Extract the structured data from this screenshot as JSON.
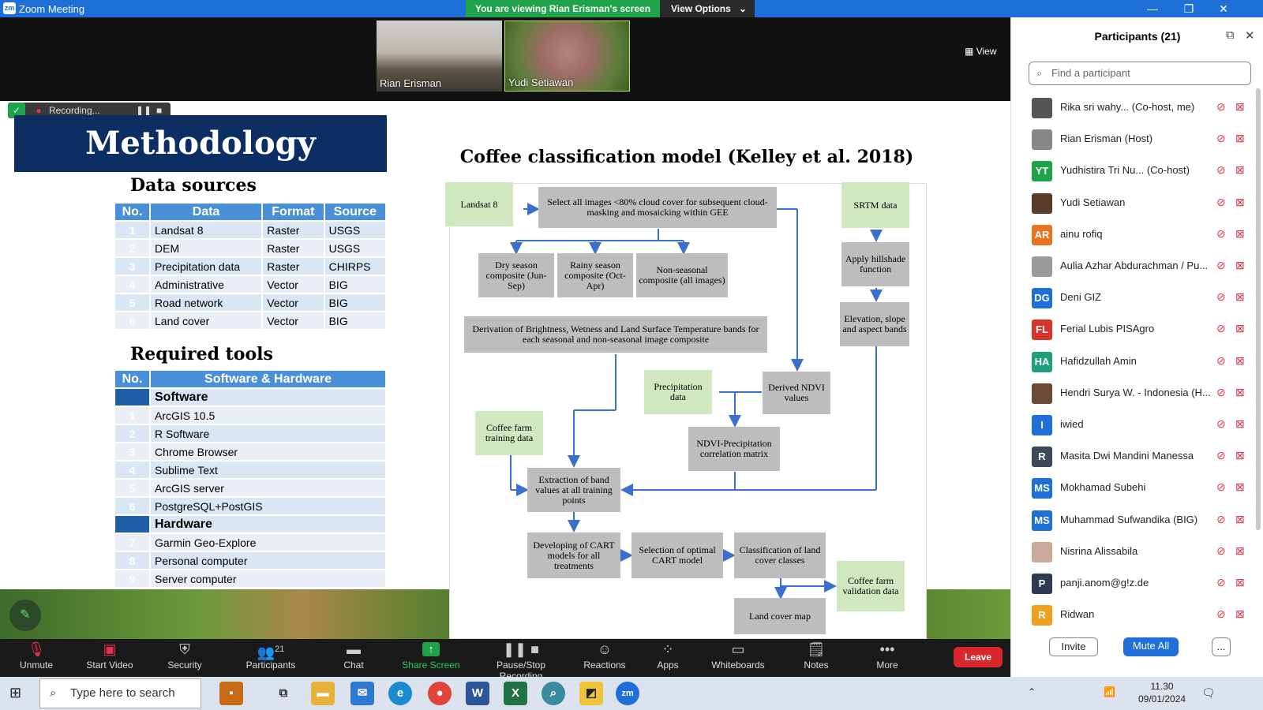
{
  "window": {
    "logo": "zm",
    "title": "Zoom Meeting",
    "banner": "You are viewing Rian Erisman's screen",
    "view_options": "View Options"
  },
  "video": {
    "tiles": [
      {
        "name": "Rian Erisman"
      },
      {
        "name": "Yudi Setiawan"
      }
    ],
    "view_label": "View"
  },
  "recording": {
    "label": "Recording..."
  },
  "slide": {
    "title": "Methodology",
    "data_sources_heading": "Data sources",
    "data_sources_columns": [
      "No.",
      "Data",
      "Format",
      "Source"
    ],
    "data_sources_rows": [
      [
        "1",
        "Landsat 8",
        "Raster",
        "USGS"
      ],
      [
        "2",
        "DEM",
        "Raster",
        "USGS"
      ],
      [
        "3",
        "Precipitation data",
        "Raster",
        "CHIRPS"
      ],
      [
        "4",
        "Administrative",
        "Vector",
        "BIG"
      ],
      [
        "5",
        "Road network",
        "Vector",
        "BIG"
      ],
      [
        "6",
        "Land cover",
        "Vector",
        "BIG"
      ]
    ],
    "tools_heading": "Required tools",
    "tools_columns": [
      "No.",
      "Software & Hardware"
    ],
    "software_label": "Software",
    "software": [
      [
        "1",
        "ArcGIS 10.5"
      ],
      [
        "2",
        "R Software"
      ],
      [
        "3",
        "Chrome Browser"
      ],
      [
        "4",
        "Sublime Text"
      ],
      [
        "5",
        "ArcGIS server"
      ],
      [
        "6",
        "PostgreSQL+PostGIS"
      ]
    ],
    "hardware_label": "Hardware",
    "hardware": [
      [
        "7",
        "Garmin Geo-Explore"
      ],
      [
        "8",
        "Personal computer"
      ],
      [
        "9",
        "Server computer"
      ]
    ],
    "diagram_title": "Coffee classification model (Kelley et al. 2018)",
    "diagram": {
      "landsat": "Landsat 8",
      "select": "Select all images <80% cloud cover for subsequent cloud-masking and mosaicking within GEE",
      "srtm": "SRTM data",
      "dry": "Dry season composite (Jun-Sep)",
      "rainy": "Rainy season composite (Oct-Apr)",
      "nonseasonal": "Non-seasonal composite (all images)",
      "hillshade": "Apply hillshade function",
      "derivation": "Derivation of Brightness, Wetness and Land Surface Temperature bands for each seasonal and non-seasonal image composite",
      "elevation": "Elevation, slope and aspect bands",
      "precip": "Precipitation data",
      "ndvi": "Derived NDVI values",
      "coffee_train": "Coffee farm training data",
      "corr": "NDVI-Precipitation correlation matrix",
      "extraction": "Extraction of band values at all training points",
      "developing": "Developing of CART models for all treatments",
      "selection": "Selection of optimal CART model",
      "classification": "Classification of land cover classes",
      "validation": "Coffee farm validation data",
      "landcover": "Land cover map"
    }
  },
  "participants": {
    "title": "Participants (21)",
    "search_placeholder": "Find a participant",
    "list": [
      {
        "name": "Rika sri wahy... (Co-host, me)",
        "initials": "",
        "color": "#555555"
      },
      {
        "name": "Rian Erisman (Host)",
        "initials": "",
        "color": "#888888"
      },
      {
        "name": "Yudhistira Tri Nu...  (Co-host)",
        "initials": "YT",
        "color": "#1fa34a"
      },
      {
        "name": "Yudi Setiawan",
        "initials": "",
        "color": "#5a3b2b"
      },
      {
        "name": "ainu rofiq",
        "initials": "AR",
        "color": "#e9731e"
      },
      {
        "name": "Aulia Azhar Abdurachman / Pu...",
        "initials": "",
        "color": "#9a9a9a"
      },
      {
        "name": "Deni GIZ",
        "initials": "DG",
        "color": "#1e6fd8"
      },
      {
        "name": "Ferial Lubis PISAgro",
        "initials": "FL",
        "color": "#d9342b"
      },
      {
        "name": "Hafidzullah Amin",
        "initials": "HA",
        "color": "#1fa07a"
      },
      {
        "name": "Hendri Surya W. - Indonesia (H...",
        "initials": "",
        "color": "#6b4a3a"
      },
      {
        "name": "iwied",
        "initials": "I",
        "color": "#1e6fd8"
      },
      {
        "name": "Masita Dwi Mandini Manessa",
        "initials": "R",
        "color": "#3e4a5a"
      },
      {
        "name": "Mokhamad Subehi",
        "initials": "MS",
        "color": "#1e6fd8"
      },
      {
        "name": "Muhammad Sufwandika (BIG)",
        "initials": "MS",
        "color": "#1e6fd8"
      },
      {
        "name": "Nisrina Alissabila",
        "initials": "",
        "color": "#c9a99a"
      },
      {
        "name": "panji.anom@g!z.de",
        "initials": "P",
        "color": "#2f3b52"
      },
      {
        "name": "Ridwan",
        "initials": "R",
        "color": "#f0a020"
      }
    ],
    "invite": "Invite",
    "mute_all": "Mute All",
    "more": "..."
  },
  "toolbar": {
    "unmute": "Unmute",
    "start_video": "Start Video",
    "security": "Security",
    "participants": "Participants",
    "participants_count": "21",
    "chat": "Chat",
    "share_screen": "Share Screen",
    "pause_stop": "Pause/Stop Recording",
    "reactions": "Reactions",
    "apps": "Apps",
    "whiteboards": "Whiteboards",
    "notes": "Notes",
    "more": "More",
    "leave": "Leave"
  },
  "taskbar": {
    "search_placeholder": "Type here to search",
    "zoom_label": "zm",
    "time": "11.30",
    "date": "09/01/2024"
  }
}
